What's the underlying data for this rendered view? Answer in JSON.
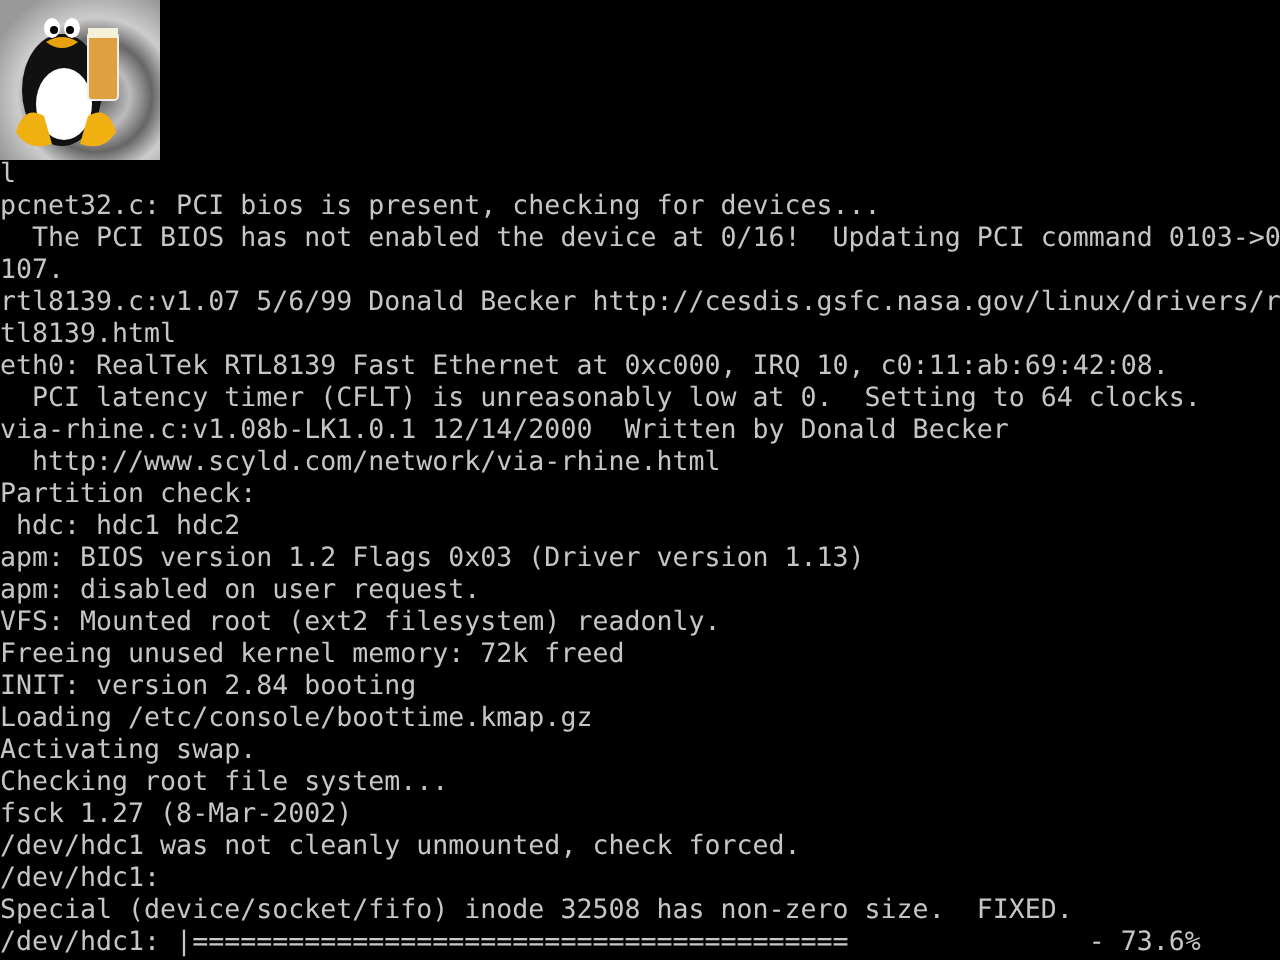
{
  "console": {
    "lines": [
      "l",
      "pcnet32.c: PCI bios is present, checking for devices...",
      "  The PCI BIOS has not enabled the device at 0/16!  Updating PCI command 0103->0",
      "107.",
      "rtl8139.c:v1.07 5/6/99 Donald Becker http://cesdis.gsfc.nasa.gov/linux/drivers/r",
      "tl8139.html",
      "eth0: RealTek RTL8139 Fast Ethernet at 0xc000, IRQ 10, c0:11:ab:69:42:08.",
      "  PCI latency timer (CFLT) is unreasonably low at 0.  Setting to 64 clocks.",
      "via-rhine.c:v1.08b-LK1.0.1 12/14/2000  Written by Donald Becker",
      "  http://www.scyld.com/network/via-rhine.html",
      "Partition check:",
      " hdc: hdc1 hdc2",
      "apm: BIOS version 1.2 Flags 0x03 (Driver version 1.13)",
      "apm: disabled on user request.",
      "VFS: Mounted root (ext2 filesystem) readonly.",
      "Freeing unused kernel memory: 72k freed",
      "INIT: version 2.84 booting",
      "Loading /etc/console/boottime.kmap.gz",
      "Activating swap.",
      "Checking root file system...",
      "fsck 1.27 (8-Mar-2002)",
      "/dev/hdc1 was not cleanly unmounted, check forced.",
      "/dev/hdc1:",
      "Special (device/socket/fifo) inode 32508 has non-zero size.  FIXED.",
      "/dev/hdc1: |=========================================               - 73.6%"
    ]
  }
}
